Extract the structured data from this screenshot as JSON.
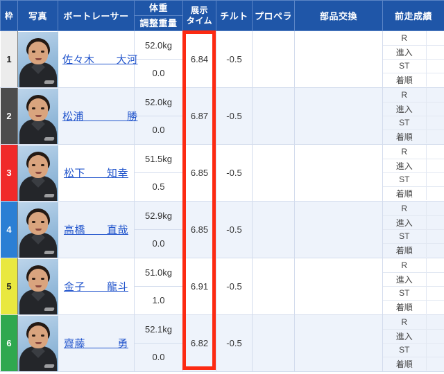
{
  "table": {
    "headers": {
      "waku": "枠",
      "photo": "写真",
      "racer": "ボートレーサー",
      "weight": "体重",
      "adjust_weight": "調整重量",
      "exhibition_time_line1": "展示",
      "exhibition_time_line2": "タイム",
      "tilt": "チルト",
      "propeller": "プロペラ",
      "parts_exchange": "部品交換",
      "previous_result": "前走成績"
    },
    "prev_result_labels": [
      "R",
      "進入",
      "ST",
      "着順"
    ],
    "lane_colors": {
      "1": "#ffffff",
      "2": "#4d4d4d",
      "3": "#f02a2a",
      "4": "#2b7fd4",
      "5": "#e9e840",
      "6": "#2fa84f"
    },
    "rows": [
      {
        "lane": "1",
        "lane_bg": "#ececec",
        "lane_fg": "#222222",
        "name": "佐々木　　大河",
        "weight": "52.0kg",
        "adjust_weight": "0.0",
        "exhibition_time": "6.84",
        "tilt": "-0.5",
        "propeller": "",
        "parts_exchange": "",
        "prev_values": [
          "",
          "",
          "",
          ""
        ]
      },
      {
        "lane": "2",
        "lane_bg": "#4d4d4d",
        "lane_fg": "#ffffff",
        "name": "松浦　　　　勝",
        "weight": "52.0kg",
        "adjust_weight": "0.0",
        "exhibition_time": "6.87",
        "tilt": "-0.5",
        "propeller": "",
        "parts_exchange": "",
        "prev_values": [
          "",
          "",
          "",
          ""
        ]
      },
      {
        "lane": "3",
        "lane_bg": "#f02a2a",
        "lane_fg": "#ffffff",
        "name": "松下　　知幸",
        "weight": "51.5kg",
        "adjust_weight": "0.5",
        "exhibition_time": "6.85",
        "tilt": "-0.5",
        "propeller": "",
        "parts_exchange": "",
        "prev_values": [
          "",
          "",
          "",
          ""
        ]
      },
      {
        "lane": "4",
        "lane_bg": "#2b7fd4",
        "lane_fg": "#ffffff",
        "name": "高橋　　直哉",
        "weight": "52.9kg",
        "adjust_weight": "0.0",
        "exhibition_time": "6.85",
        "tilt": "-0.5",
        "propeller": "",
        "parts_exchange": "",
        "prev_values": [
          "",
          "",
          "",
          ""
        ]
      },
      {
        "lane": "5",
        "lane_bg": "#e9e840",
        "lane_fg": "#222222",
        "name": "金子　　龍斗",
        "weight": "51.0kg",
        "adjust_weight": "1.0",
        "exhibition_time": "6.91",
        "tilt": "-0.5",
        "propeller": "",
        "parts_exchange": "",
        "prev_values": [
          "",
          "",
          "",
          ""
        ]
      },
      {
        "lane": "6",
        "lane_bg": "#2fa84f",
        "lane_fg": "#ffffff",
        "name": "齋藤　　　勇",
        "weight": "52.1kg",
        "adjust_weight": "0.0",
        "exhibition_time": "6.82",
        "tilt": "-0.5",
        "propeller": "",
        "parts_exchange": "",
        "prev_values": [
          "",
          "",
          "",
          ""
        ]
      }
    ]
  },
  "highlight": {
    "color": "#fc2a12",
    "target_column": "展示タイム"
  }
}
